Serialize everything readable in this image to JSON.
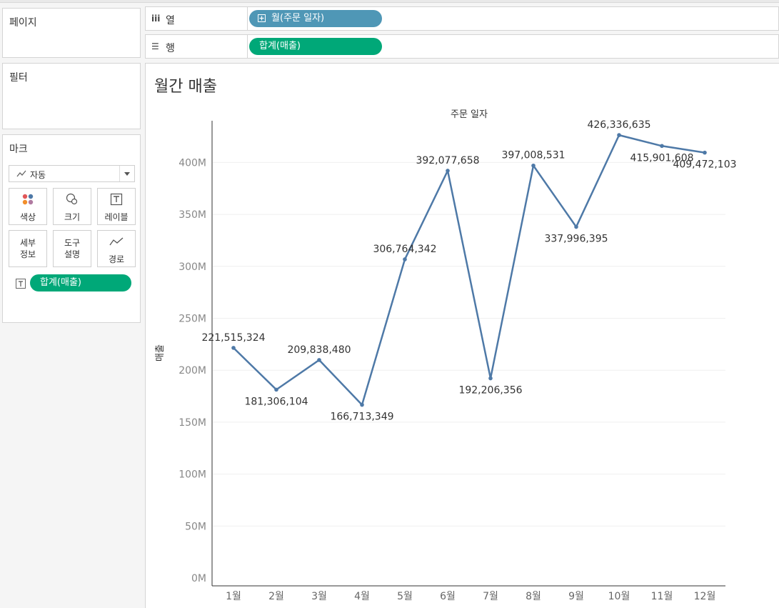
{
  "panels": {
    "pages": {
      "title": "페이지"
    },
    "filters": {
      "title": "필터"
    },
    "marks": {
      "title": "마크",
      "mark_type": "자동",
      "buttons": [
        {
          "label": "색상",
          "icon": "color-dots-icon"
        },
        {
          "label": "크기",
          "icon": "size-circles-icon"
        },
        {
          "label": "레이블",
          "icon": "label-t-icon"
        },
        {
          "label": "세부\n정보",
          "icon": ""
        },
        {
          "label": "도구\n설명",
          "icon": ""
        },
        {
          "label": "경로",
          "icon": "path-line-icon"
        }
      ],
      "field_pill": "합계(매출)"
    }
  },
  "shelves": {
    "columns": {
      "label": "열",
      "icon": "iii",
      "pill": "월(주문 일자)"
    },
    "rows": {
      "label": "행",
      "icon": "☰",
      "pill": "합계(매출)"
    }
  },
  "colors": {
    "line": "#4e79a7",
    "pill_blue": "#4f97b6",
    "pill_green": "#00a878",
    "grid": "#efefef"
  },
  "sheet": {
    "title": "월간 매출"
  },
  "chart_data": {
    "type": "line",
    "title": "월간 매출",
    "xlabel": "주문 일자",
    "ylabel": "매출",
    "categories": [
      "1월",
      "2월",
      "3월",
      "4월",
      "5월",
      "6월",
      "7월",
      "8월",
      "9월",
      "10월",
      "11월",
      "12월"
    ],
    "values": [
      221515324,
      181306104,
      209838480,
      166713349,
      306764342,
      392077658,
      192206356,
      397008531,
      337996395,
      426336635,
      415901608,
      409472103
    ],
    "data_labels": [
      "221,515,324",
      "181,306,104",
      "209,838,480",
      "166,713,349",
      "306,764,342",
      "392,077,658",
      "192,206,356",
      "397,008,531",
      "337,996,395",
      "426,336,635",
      "415,901,608",
      "409,472,103"
    ],
    "ylim": [
      0,
      430000000
    ],
    "yticks": [
      0,
      50000000,
      100000000,
      150000000,
      200000000,
      250000000,
      300000000,
      350000000,
      400000000
    ],
    "ytick_labels": [
      "0M",
      "50M",
      "100M",
      "150M",
      "200M",
      "250M",
      "300M",
      "350M",
      "400M"
    ],
    "grid": true
  }
}
